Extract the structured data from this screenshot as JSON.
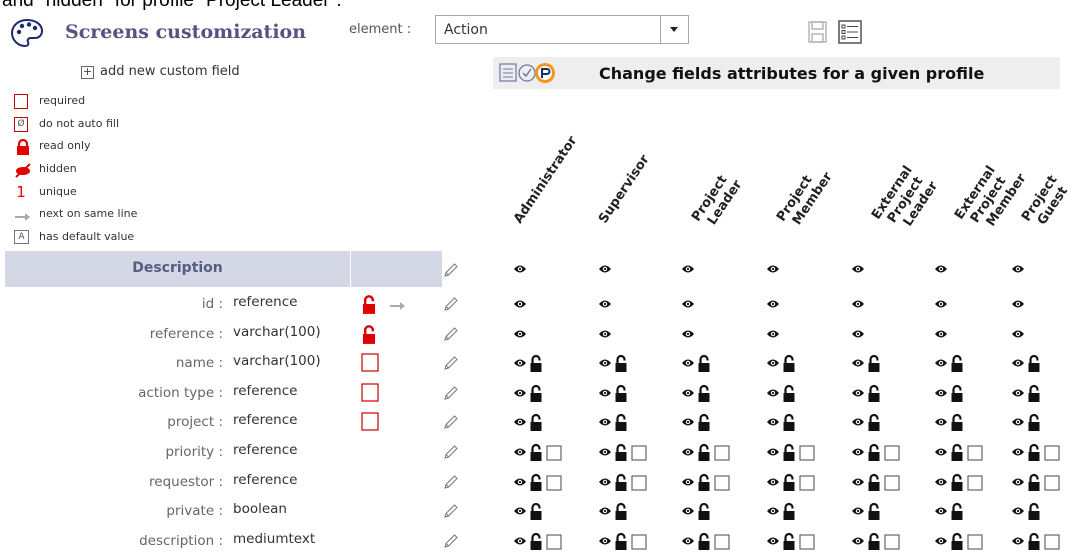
{
  "caption": "and \"hidden\" for profile \"Project Leader\".",
  "title": "Screens customization",
  "element_label": "element :",
  "element_value": "Action",
  "add_field": "add new custom field",
  "legend": [
    {
      "icon": "required-box-icon",
      "label": "required"
    },
    {
      "icon": "no-autofill-icon",
      "label": "do not auto fill"
    },
    {
      "icon": "lock-red-icon",
      "label": "read only"
    },
    {
      "icon": "hidden-icon",
      "label": "hidden"
    },
    {
      "icon": "unique-icon",
      "label": "unique"
    },
    {
      "icon": "arrow-next-icon",
      "label": "next on same line"
    },
    {
      "icon": "default-value-icon",
      "label": "has default value"
    }
  ],
  "banner_title": "Change fields attributes for a given profile",
  "profiles": [
    [
      "Administrator"
    ],
    [
      "Supervisor"
    ],
    [
      "Project",
      "Leader"
    ],
    [
      "Project",
      "Member"
    ],
    [
      "External",
      "Project",
      "Leader"
    ],
    [
      "External",
      "Project",
      "Member"
    ],
    [
      "Project",
      "Guest"
    ]
  ],
  "desc_header": "Description",
  "fields": [
    {
      "name": "id :",
      "type": "reference",
      "attrs": [
        "lock",
        "arrow"
      ],
      "profile_icons": "eye"
    },
    {
      "name": "reference :",
      "type": "varchar(100)",
      "attrs": [
        "lock"
      ],
      "profile_icons": "eye"
    },
    {
      "name": "name :",
      "type": "varchar(100)",
      "attrs": [
        "required"
      ],
      "profile_icons": "eye-lock"
    },
    {
      "name": "action type :",
      "type": "reference",
      "attrs": [
        "required"
      ],
      "profile_icons": "eye-lock"
    },
    {
      "name": "project :",
      "type": "reference",
      "attrs": [
        "required"
      ],
      "profile_icons": "eye-lock"
    },
    {
      "name": "priority :",
      "type": "reference",
      "attrs": [],
      "profile_icons": "eye-lock-box"
    },
    {
      "name": "requestor :",
      "type": "reference",
      "attrs": [],
      "profile_icons": "eye-lock-box"
    },
    {
      "name": "private :",
      "type": "boolean",
      "attrs": [],
      "profile_icons": "eye-lock"
    },
    {
      "name": "description :",
      "type": "mediumtext",
      "attrs": [],
      "profile_icons": "eye-lock-box"
    }
  ],
  "header_row_icons": "eye",
  "colors": {
    "title": "#545381",
    "header_bg": "#d4d7e6",
    "banner_bg": "#eeeeee",
    "red": "#e00000"
  }
}
